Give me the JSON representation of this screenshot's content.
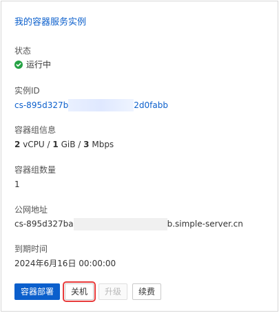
{
  "card": {
    "title": "我的容器服务实例"
  },
  "status": {
    "label": "状态",
    "value": "运行中",
    "icon": "check-circle-icon",
    "color": "#25a244"
  },
  "instance": {
    "label": "实例ID",
    "prefix": "cs-895d327b",
    "suffix": "2d0fabb"
  },
  "group_info": {
    "label": "容器组信息",
    "cpu_value": "2",
    "cpu_unit": "vCPU",
    "separator": "/",
    "memory_value": "1",
    "memory_unit": "GiB",
    "bandwidth_value": "3",
    "bandwidth_unit": "Mbps"
  },
  "group_count": {
    "label": "容器组数量",
    "value": "1"
  },
  "public_address": {
    "label": "公网地址",
    "prefix": "cs-895d327ba",
    "suffix": "b.simple-server.cn"
  },
  "expiry": {
    "label": "到期时间",
    "value": "2024年6月16日 00:00:00"
  },
  "actions": {
    "deploy": "容器部署",
    "shutdown": "关机",
    "upgrade": "升级",
    "renew": "续费"
  }
}
